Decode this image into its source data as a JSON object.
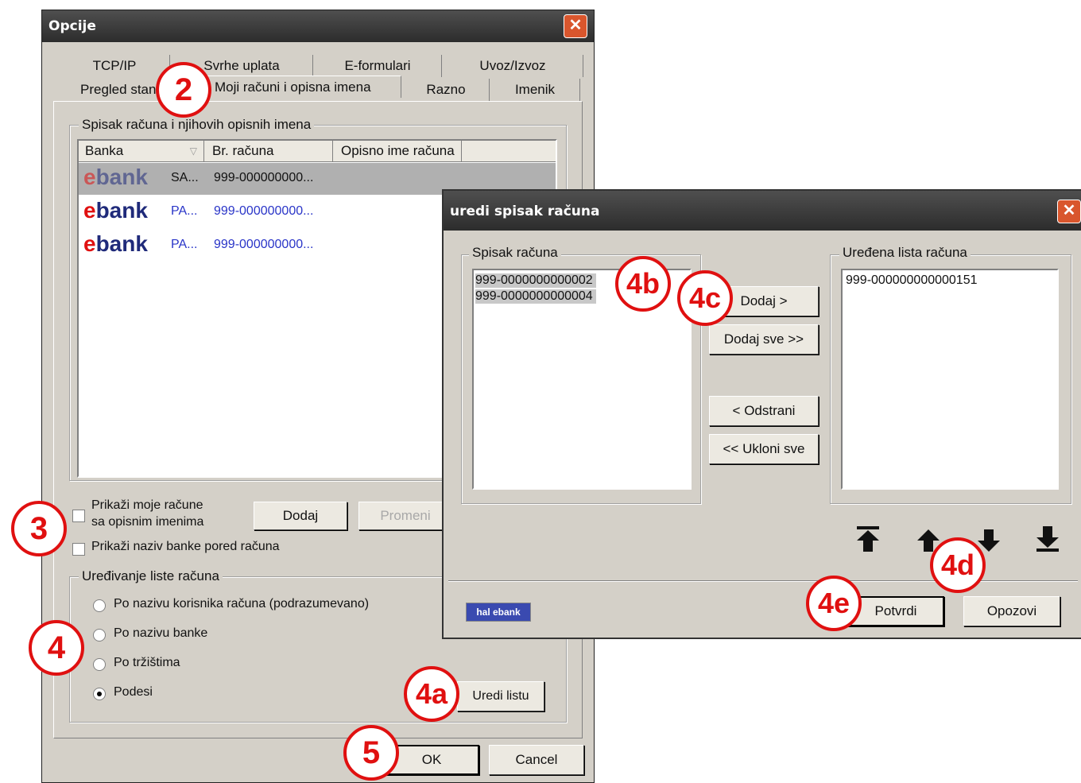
{
  "opcije": {
    "title": "Opcije",
    "close_glyph": "✕",
    "tabs_row1": [
      "TCP/IP",
      "Svrhe uplata",
      "E-formulari",
      "Uvoz/Izvoz"
    ],
    "tabs_row2": [
      "Pregled stan",
      "Moji računi i opisna imena",
      "Razno",
      "Imenik"
    ],
    "group_accounts_label": "Spisak računa i njihovih opisnih imena",
    "columns": [
      "Banka",
      "Br. računa",
      "Opisno ime računa"
    ],
    "rows": [
      {
        "bank_logo": "bank",
        "type": "SA...",
        "account": "999-000000000..."
      },
      {
        "bank_logo": "bank",
        "type": "PA...",
        "account": "999-000000000..."
      },
      {
        "bank_logo": "bank",
        "type": "PA...",
        "account": "999-000000000..."
      }
    ],
    "chk_show_descriptive_line1": "Prikaži moje račune",
    "chk_show_descriptive_line2": "sa opisnim imenima",
    "chk_show_bank_name": "Prikaži naziv banke pored računa",
    "add_button": "Dodaj",
    "change_button": "Promeni",
    "group_ordering_label": "Uređivanje liste računa",
    "radio_options": [
      "Po nazivu korisnika računa (podrazumevano)",
      "Po nazivu banke",
      "Po tržištima",
      "Podesi"
    ],
    "selected_radio": "Podesi",
    "edit_list_button": "Uredi listu",
    "ok_button": "OK",
    "cancel_button": "Cancel"
  },
  "uredi": {
    "title": "uredi spisak računa",
    "close_glyph": "✕",
    "left_group_label": "Spisak računa",
    "left_items": [
      "999-0000000000002",
      "999-0000000000004"
    ],
    "right_group_label": "Uređena lista računa",
    "right_items": [
      "999-000000000000151"
    ],
    "add_button": "Dodaj >",
    "add_all_button": "Dodaj sve >>",
    "remove_button": "< Odstrani",
    "remove_all_button": "<< Ukloni sve",
    "move_icons": [
      "move-top-icon",
      "move-up-icon",
      "move-down-icon",
      "move-bottom-icon"
    ],
    "logo_text": "hal ebank",
    "confirm_button": "Potvrdi",
    "cancel_button": "Opozovi"
  },
  "markers": [
    "2",
    "3",
    "4",
    "4a",
    "4b",
    "4c",
    "4d",
    "4e",
    "5"
  ],
  "colors": {
    "marker_red": "#e01010",
    "title_dark": "#333333",
    "close_orange": "#d9562d",
    "ebank_blue": "#1f2a7a",
    "link_blue": "#2a35c8"
  }
}
